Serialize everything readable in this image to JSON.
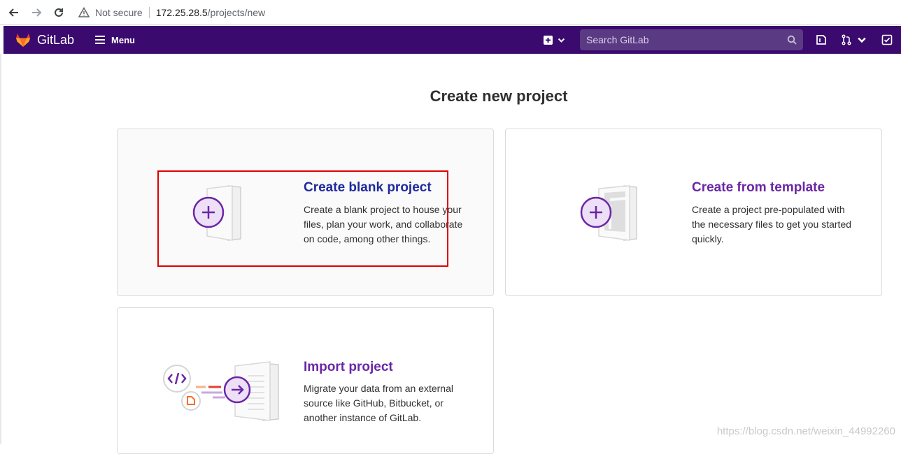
{
  "browser": {
    "not_secure": "Not secure",
    "host": "172.25.28.5",
    "path": "/projects/new"
  },
  "header": {
    "brand": "GitLab",
    "menu_label": "Menu",
    "search_placeholder": "Search GitLab",
    "header_color": "#3b0a6e"
  },
  "page": {
    "title": "Create new project"
  },
  "panels": [
    {
      "title": "Create blank project",
      "description": "Create a blank project to house your files, plan your work, and collaborate on code, among other things.",
      "icon": "blank-project-illustration"
    },
    {
      "title": "Create from template",
      "description": "Create a project pre-populated with the necessary files to get you started quickly.",
      "icon": "template-project-illustration"
    },
    {
      "title": "Import project",
      "description": "Migrate your data from an external source like GitHub, Bitbucket, or another instance of GitLab.",
      "icon": "import-project-illustration"
    }
  ],
  "watermark": "https://blog.csdn.net/weixin_44992260",
  "colors": {
    "accent": "#6b26a6",
    "blank_title": "#1f2a9c",
    "highlight": "#e00000"
  }
}
